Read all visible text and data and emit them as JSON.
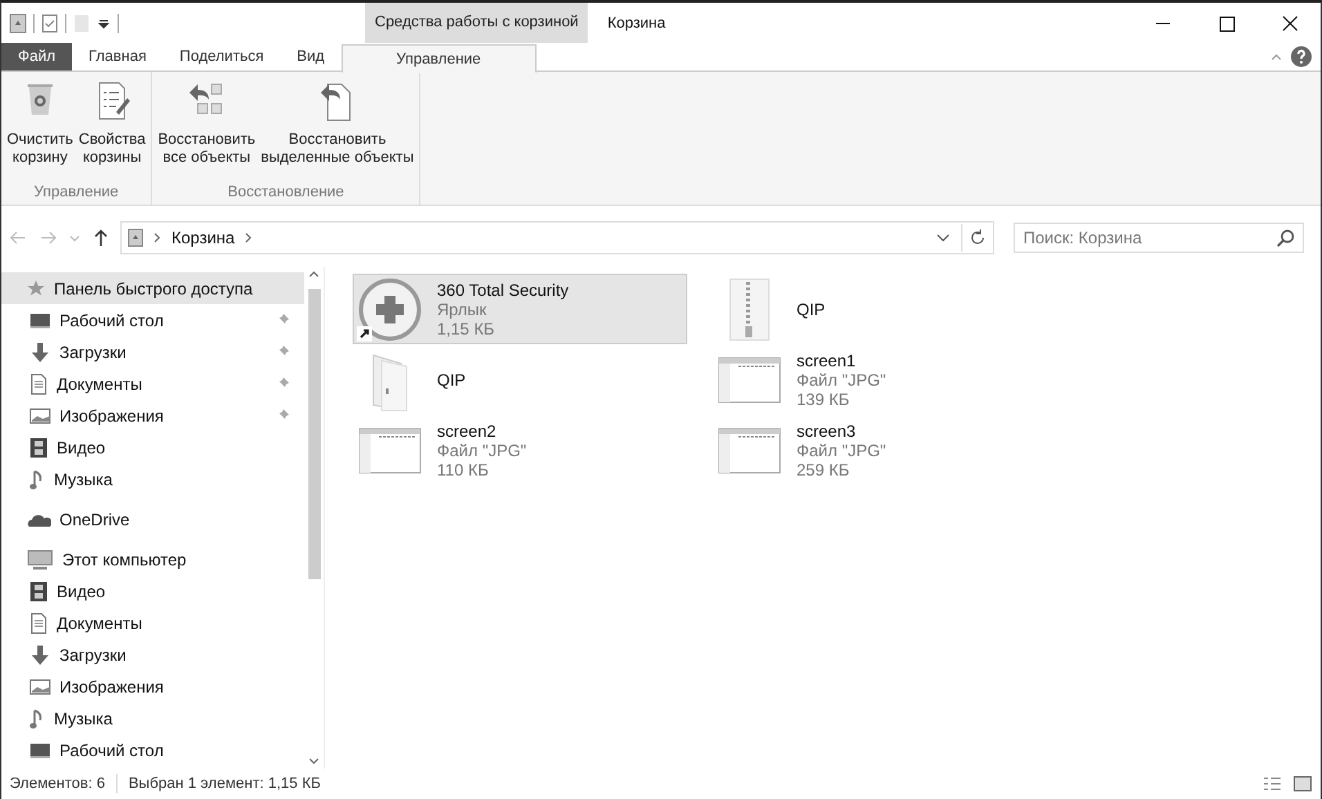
{
  "window": {
    "title": "Корзина",
    "context_tab": "Средства работы с корзиной"
  },
  "tabs": [
    {
      "label": "Файл",
      "kind": "file",
      "selected": false
    },
    {
      "label": "Главная",
      "kind": "normal",
      "selected": false
    },
    {
      "label": "Поделиться",
      "kind": "normal",
      "selected": false
    },
    {
      "label": "Вид",
      "kind": "normal",
      "selected": false
    },
    {
      "label": "Управление",
      "kind": "context",
      "selected": true
    }
  ],
  "ribbon_groups": [
    {
      "label": "Управление",
      "buttons": [
        {
          "kind": "bin",
          "lines": [
            "Очистить",
            "корзину"
          ]
        },
        {
          "kind": "props",
          "lines": [
            "Свойства",
            "корзины"
          ]
        }
      ]
    },
    {
      "label": "Восстановление",
      "buttons": [
        {
          "kind": "restoreall",
          "lines": [
            "Восстановить",
            "все объекты"
          ]
        },
        {
          "kind": "restoresel",
          "lines": [
            "Восстановить",
            "выделенные объекты"
          ]
        }
      ]
    }
  ],
  "address": {
    "path": [
      "Корзина"
    ]
  },
  "search": {
    "placeholder": "Поиск: Корзина"
  },
  "sidebar": {
    "items": [
      {
        "label": "Панель быстрого доступа",
        "kind": "star",
        "selected": true,
        "children": [
          {
            "label": "Рабочий стол",
            "kind": "desktop",
            "pinned": true,
            "selected": false
          },
          {
            "label": "Загрузки",
            "kind": "download",
            "pinned": true,
            "selected": false
          },
          {
            "label": "Документы",
            "kind": "doc",
            "pinned": true,
            "selected": false
          },
          {
            "label": "Изображения",
            "kind": "image",
            "pinned": true,
            "selected": false
          },
          {
            "label": "Видео",
            "kind": "video",
            "pinned": false,
            "selected": false
          },
          {
            "label": "Музыка",
            "kind": "music",
            "pinned": false,
            "selected": false
          }
        ]
      },
      {
        "label": "OneDrive",
        "kind": "cloud",
        "selected": false
      },
      {
        "label": "Этот компьютер",
        "kind": "pc",
        "selected": false,
        "children": [
          {
            "label": "Видео",
            "kind": "video",
            "pinned": false,
            "selected": false
          },
          {
            "label": "Документы",
            "kind": "doc",
            "pinned": false,
            "selected": false
          },
          {
            "label": "Загрузки",
            "kind": "download",
            "pinned": false,
            "selected": false
          },
          {
            "label": "Изображения",
            "kind": "image",
            "pinned": false,
            "selected": false
          },
          {
            "label": "Музыка",
            "kind": "music",
            "pinned": false,
            "selected": false
          },
          {
            "label": "Рабочий стол",
            "kind": "desktop",
            "pinned": false,
            "selected": false
          }
        ]
      }
    ]
  },
  "files": [
    {
      "name": "360 Total Security",
      "type": "Ярлык",
      "size": "1,15 КБ",
      "kind": "shortcut",
      "selected": true
    },
    {
      "name": "QIP",
      "kind": "folder",
      "selected": false
    },
    {
      "name": "screen2",
      "type": "Файл \"JPG\"",
      "size": "110 КБ",
      "kind": "image",
      "selected": false
    },
    {
      "name": "QIP",
      "kind": "zip",
      "selected": false
    },
    {
      "name": "screen1",
      "type": "Файл \"JPG\"",
      "size": "139 КБ",
      "kind": "image",
      "selected": false
    },
    {
      "name": "screen3",
      "type": "Файл \"JPG\"",
      "size": "259 КБ",
      "kind": "image",
      "selected": false
    }
  ],
  "status_bar": {
    "count": "Элементов: 6",
    "selection": "Выбран 1 элемент: 1,15 КБ"
  }
}
